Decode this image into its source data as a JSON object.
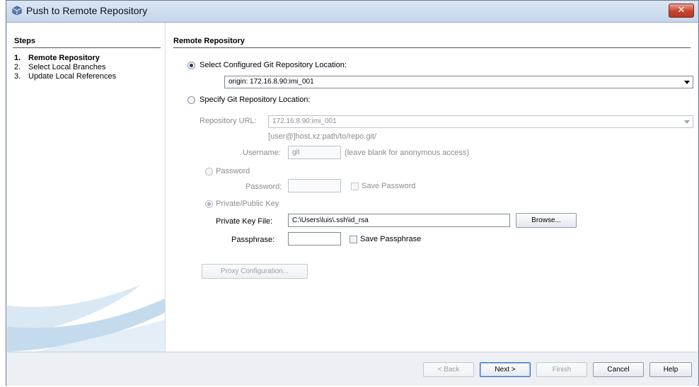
{
  "window": {
    "title": "Push to Remote Repository",
    "close_label": "✕"
  },
  "steps": {
    "header": "Steps",
    "items": [
      {
        "num": "1.",
        "label": "Remote Repository",
        "active": true
      },
      {
        "num": "2.",
        "label": "Select Local Branches",
        "active": false
      },
      {
        "num": "3.",
        "label": "Update Local References",
        "active": false
      }
    ]
  },
  "main": {
    "header": "Remote Repository",
    "option_configured": {
      "label": "Select Configured Git Repository Location:",
      "selected": true,
      "value": "origin: 172.16.8.90:imi_001"
    },
    "option_specify": {
      "label": "Specify Git Repository Location:",
      "selected": false
    },
    "repo_url": {
      "label": "Repository URL:",
      "value": "172.16.8.90:imi_001",
      "hint": "[user@]host.xz:path/to/repo.git/"
    },
    "username": {
      "label": "Username:",
      "value": "git",
      "hint": "(leave blank for anonymous access)"
    },
    "password_option": {
      "label": "Password"
    },
    "password": {
      "label": "Password:",
      "value": "",
      "save_label": "Save Password"
    },
    "key_option": {
      "label": "Private/Public Key"
    },
    "private_key": {
      "label": "Private Key File:",
      "value": "C:\\Users\\luis\\.ssh\\id_rsa",
      "browse_label": "Browse..."
    },
    "passphrase": {
      "label": "Passphrase:",
      "value": "",
      "save_label": "Save Passphrase"
    },
    "proxy_label": "Proxy Configuration..."
  },
  "footer": {
    "back": "< Back",
    "next": "Next >",
    "finish": "Finish",
    "cancel": "Cancel",
    "help": "Help"
  }
}
